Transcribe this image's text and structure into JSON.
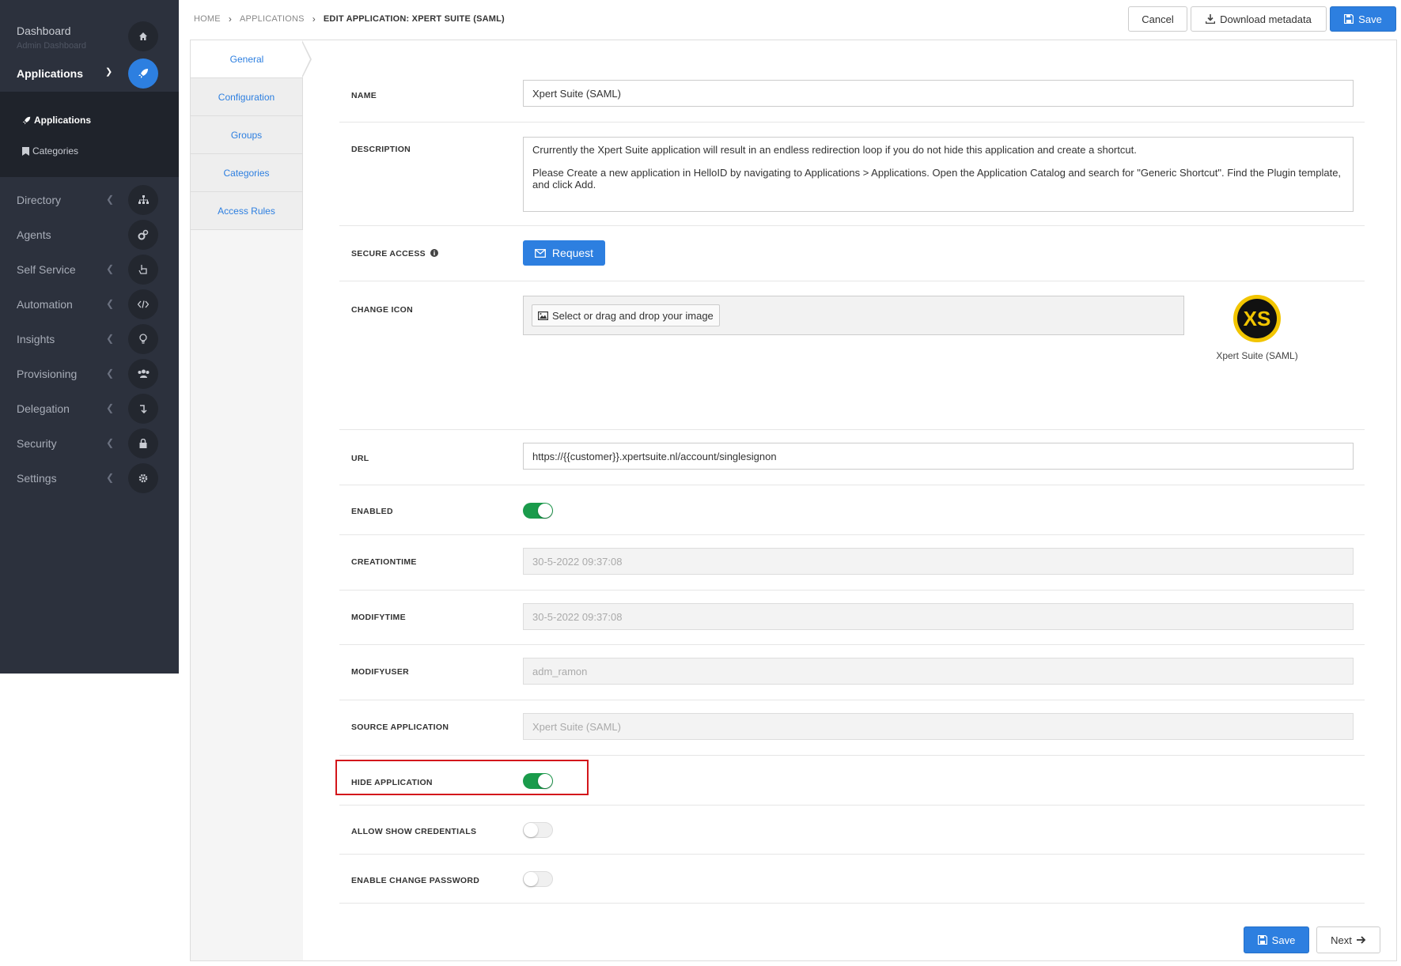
{
  "sidebar": {
    "dashboard_label": "Dashboard",
    "dashboard_sub": "Admin Dashboard",
    "applications_label": "Applications",
    "sub_items": [
      {
        "label": "Applications"
      },
      {
        "label": "Categories"
      }
    ],
    "nav": [
      {
        "label": "Directory"
      },
      {
        "label": "Agents"
      },
      {
        "label": "Self Service"
      },
      {
        "label": "Automation"
      },
      {
        "label": "Insights"
      },
      {
        "label": "Provisioning"
      },
      {
        "label": "Delegation"
      },
      {
        "label": "Security"
      },
      {
        "label": "Settings"
      }
    ]
  },
  "breadcrumb": {
    "home": "HOME",
    "applications": "APPLICATIONS",
    "current": "EDIT APPLICATION: XPERT SUITE (SAML)"
  },
  "toolbar": {
    "cancel": "Cancel",
    "download_metadata": "Download metadata",
    "save": "Save"
  },
  "tabs": [
    {
      "label": "General"
    },
    {
      "label": "Configuration"
    },
    {
      "label": "Groups"
    },
    {
      "label": "Categories"
    },
    {
      "label": "Access Rules"
    }
  ],
  "form": {
    "name": {
      "label": "NAME",
      "value": "Xpert Suite (SAML)"
    },
    "description": {
      "label": "DESCRIPTION",
      "line1": "Crurrently the Xpert Suite application will result in an endless redirection loop if you do not hide this application and create a shortcut.",
      "line2": "Please Create a new application in HelloID by navigating to Applications > Applications. Open the Application Catalog and search for \"Generic Shortcut\". Find the Plugin template, and click Add."
    },
    "secure_access": {
      "label": "SECURE ACCESS",
      "button": "Request"
    },
    "change_icon": {
      "label": "CHANGE ICON",
      "dropzone_button": "Select or drag and drop your image",
      "logo_text": "XS",
      "logo_caption": "Xpert Suite (SAML)"
    },
    "url": {
      "label": "URL",
      "value": "https://{{customer}}.xpertsuite.nl/account/singlesignon"
    },
    "enabled": {
      "label": "ENABLED",
      "on": true
    },
    "creationtime": {
      "label": "CREATIONTIME",
      "value": "30-5-2022 09:37:08"
    },
    "modifytime": {
      "label": "MODIFYTIME",
      "value": "30-5-2022 09:37:08"
    },
    "modifyuser": {
      "label": "MODIFYUSER",
      "value": "adm_ramon"
    },
    "source_application": {
      "label": "SOURCE APPLICATION",
      "value": "Xpert Suite (SAML)"
    },
    "hide_application": {
      "label": "HIDE APPLICATION",
      "on": true
    },
    "allow_show_credentials": {
      "label": "ALLOW SHOW CREDENTIALS",
      "on": false
    },
    "enable_change_password": {
      "label": "ENABLE CHANGE PASSWORD",
      "on": false
    }
  },
  "footer": {
    "save": "Save",
    "next": "Next"
  },
  "colors": {
    "sidebar_bg": "#2c313d",
    "accent": "#2d7fe0",
    "toggle_on": "#1a9b4b",
    "highlight": "#d3161b"
  }
}
